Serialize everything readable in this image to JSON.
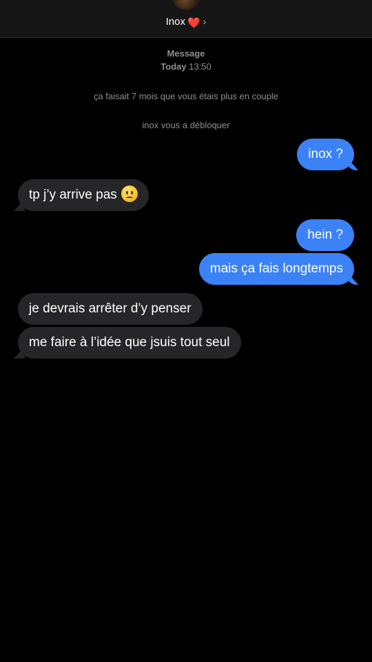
{
  "header": {
    "contact_name": "Inox",
    "heart": "❤️",
    "chevron": "›",
    "avatar": "contact-avatar"
  },
  "thread_meta": {
    "kind": "Message",
    "day": "Today",
    "time": "13:50"
  },
  "system_notes": [
    "ça faisait 7 mois que vous étais plus en couple",
    "inox vous a débloquer"
  ],
  "messages": [
    {
      "direction": "outgoing",
      "text": "inox ?"
    },
    {
      "direction": "incoming",
      "text": "tp j’y arrive pas",
      "emoji": "slightly-frowning-face"
    },
    {
      "direction": "outgoing",
      "text": "hein ?"
    },
    {
      "direction": "outgoing",
      "text": "mais ça fais longtemps"
    },
    {
      "direction": "incoming",
      "text": "je devrais arrêter d’y penser"
    },
    {
      "direction": "incoming",
      "text": "me faire à l’idée que jsuis tout seul"
    }
  ],
  "colors": {
    "background": "#000000",
    "outgoing_bubble": "#3b82f6",
    "incoming_bubble": "#262628",
    "meta_text": "#8e8e93"
  }
}
